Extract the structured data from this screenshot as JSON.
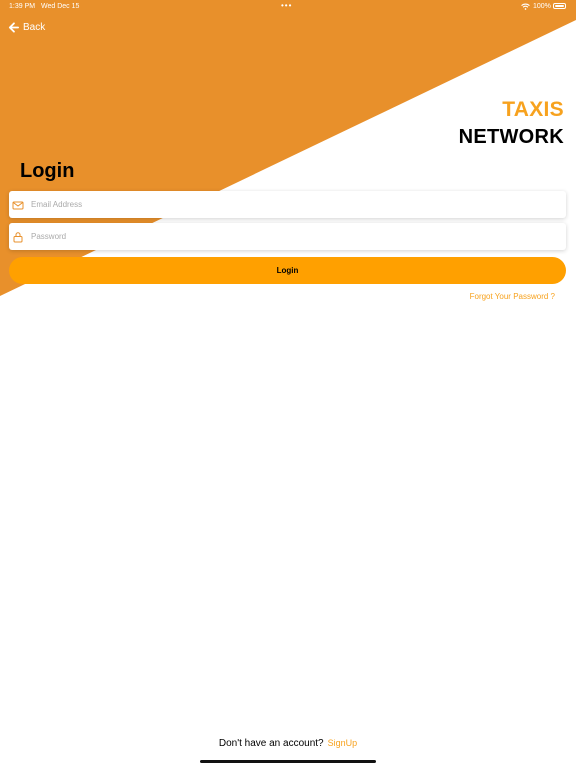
{
  "status_bar": {
    "time": "1:39 PM",
    "date": "Wed Dec 15",
    "dots": "•••",
    "battery": "100%",
    "wifi_icon": "wifi-icon",
    "battery_icon": "battery-icon"
  },
  "nav": {
    "back_label": "Back",
    "back_icon": "arrow-left-icon"
  },
  "brand": {
    "line1": "TAXIS",
    "line2": "NETWORK"
  },
  "form": {
    "title": "Login",
    "email": {
      "placeholder": "Email Address",
      "value": "",
      "icon": "envelope-icon"
    },
    "password": {
      "placeholder": "Password",
      "value": "",
      "icon": "lock-icon"
    },
    "submit_label": "Login",
    "forgot_label": "Forgot Your Password ?"
  },
  "footer": {
    "prompt": "Don't have an account?",
    "signup_label": "SignUp"
  },
  "colors": {
    "primary": "#ffa000",
    "background_shape": "#e8902b",
    "accent_text": "#f7a21e"
  }
}
